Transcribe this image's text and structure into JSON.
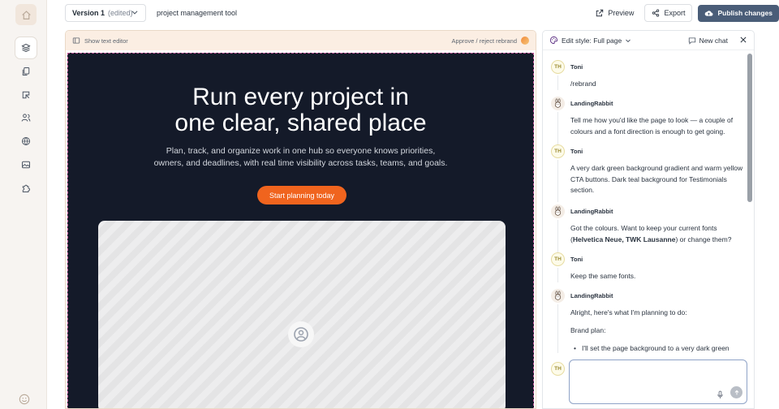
{
  "sidebar": {
    "icons": [
      "home-icon",
      "layers-icon",
      "pages-icon",
      "brush-icon",
      "users-icon",
      "globe-icon",
      "image-icon",
      "puzzle-icon"
    ],
    "footer_icon": "smile-icon"
  },
  "topbar": {
    "version_label": "Version 1",
    "version_status": "(edited)",
    "project_name": "project management tool",
    "preview_label": "Preview",
    "export_label": "Export",
    "publish_label": "Publish changes"
  },
  "canvas": {
    "toolbar": {
      "text_editor_label": "Show text editor",
      "rebrand_label": "Approve / reject rebrand"
    },
    "hero": {
      "title_line1": "Run every project in",
      "title_line2": "one clear, shared place",
      "subtitle_line1": "Plan, track, and organize work in one hub so everyone knows priorities,",
      "subtitle_line2": "owners, and deadlines, with real time visibility across tasks, teams, and goals.",
      "cta_label": "Start planning today"
    }
  },
  "chat": {
    "style_label": "Edit style: Full page",
    "new_chat_label": "New chat",
    "messages": [
      {
        "initials": "TH",
        "author": "Toni",
        "text": "/rebrand"
      },
      {
        "author": "LandingRabbit",
        "text": "Tell me how you'd like the page to look — a couple of colours and a font direction is enough to get going."
      },
      {
        "initials": "TH",
        "author": "Toni",
        "text": "A very dark green background gradient and warm yellow CTA buttons. Dark teal background for Testimonials section."
      },
      {
        "author": "LandingRabbit",
        "text_before": "Got the colours. Want to keep your current fonts (",
        "text_bold": "Helvetica Neue, TWK Lausanne",
        "text_after": ") or change them?"
      },
      {
        "initials": "TH",
        "author": "Toni",
        "text": "Keep the same fonts."
      },
      {
        "author": "LandingRabbit",
        "text": "Alright, here's what I'm planning to do:",
        "subheading": "Brand plan:",
        "bullet": "I'll set the page background to a very dark green"
      }
    ],
    "composer_initials": "TH",
    "composer_placeholder": ""
  },
  "colors": {
    "hero_bg": "#141a29",
    "cta": "#f0641e",
    "publish_bg": "#4a5d78",
    "accent_frame": "#c45a9a"
  }
}
